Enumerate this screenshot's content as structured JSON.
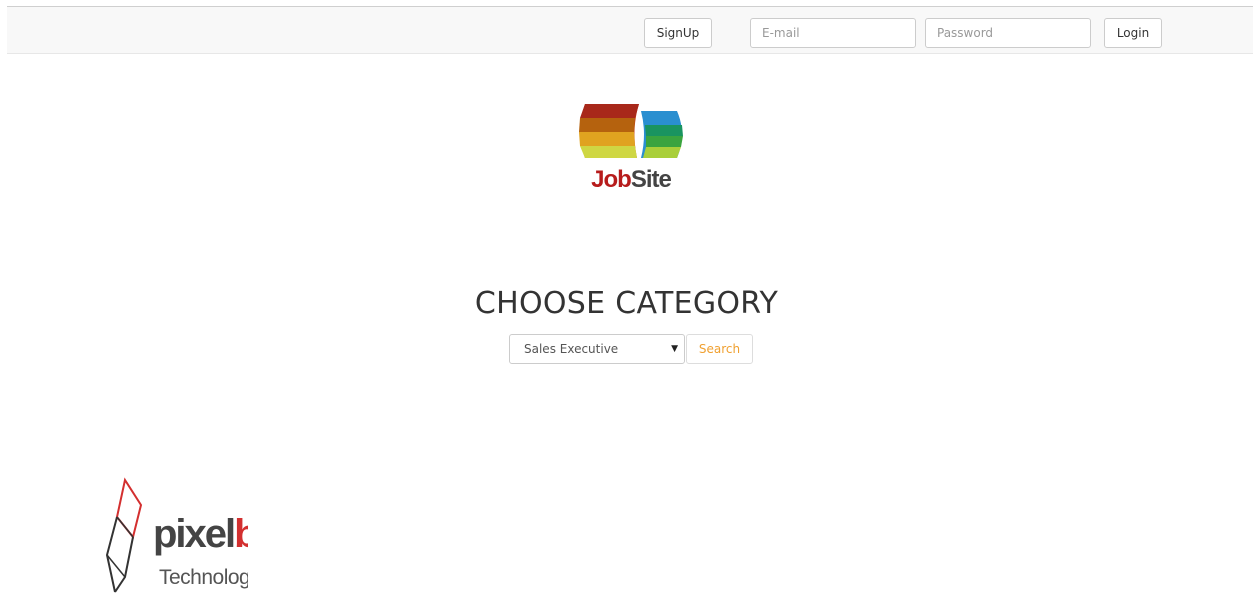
{
  "header": {
    "signup_label": "SignUp",
    "email_placeholder": "E-mail",
    "password_placeholder": "Password",
    "login_label": "Login"
  },
  "logo": {
    "word1": "Job",
    "word2": "Site"
  },
  "main": {
    "heading": "CHOOSE CATEGORY",
    "category_selected": "Sales Executive",
    "search_label": "Search"
  },
  "footer": {
    "brand_part1": "pixel",
    "brand_part2": "box",
    "brand_sub": "Technologies"
  },
  "colors": {
    "accent_orange": "#f0a030",
    "brand_red": "#b71c1c"
  }
}
